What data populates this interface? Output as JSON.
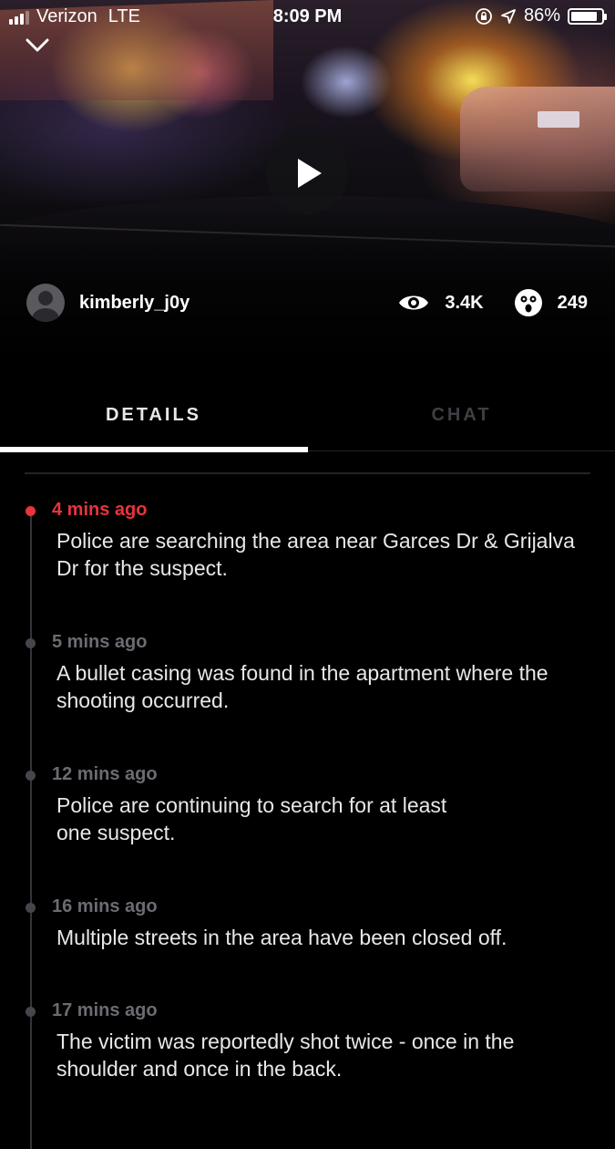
{
  "status_bar": {
    "carrier": "Verizon",
    "network": "LTE",
    "time": "8:09 PM",
    "battery": "86%",
    "battery_level": 0.86
  },
  "video": {
    "username": "kimberly_j0y",
    "views": "3.4K",
    "reactions": "249"
  },
  "tabs": [
    {
      "label": "DETAILS",
      "active": true
    },
    {
      "label": "CHAT",
      "active": false
    }
  ],
  "timeline": [
    {
      "time": "4 mins ago",
      "text": "Police are searching the area near Garces Dr & Grijalva Dr for the suspect."
    },
    {
      "time": "5 mins ago",
      "text": "A bullet casing was found in the apartment where the shooting occurred."
    },
    {
      "time": "12 mins ago",
      "text": "Police are continuing to search for at least one suspect."
    },
    {
      "time": "16 mins ago",
      "text": "Multiple streets in the area have been closed off."
    },
    {
      "time": "17 mins ago",
      "text": "The victim was reportedly shot twice - once in the shoulder and once in the back."
    }
  ],
  "colors": {
    "accent_red": "#e8343d",
    "inactive_tab": "#3e3f45"
  }
}
